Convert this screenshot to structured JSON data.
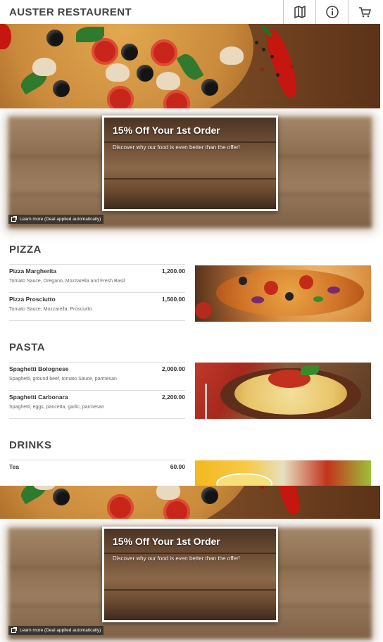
{
  "header": {
    "brand": "AUSTER RESTAURENT",
    "buttons": [
      {
        "name": "map-button",
        "icon": "map-icon"
      },
      {
        "name": "info-button",
        "icon": "info-icon"
      },
      {
        "name": "cart-button",
        "icon": "cart-icon"
      }
    ]
  },
  "promo": {
    "title": "15% Off Your 1st Order",
    "subtitle": "Discover why our food is even better than the offer!",
    "learn_more": "Learn more (Deal applied automatically)"
  },
  "menu": {
    "pizza": {
      "heading": "PIZZA",
      "items": [
        {
          "name": "Pizza Margherita",
          "price": "1,200.00",
          "desc": "Tomato Sauce, Oregano, Mozzarella and Fresh Basil"
        },
        {
          "name": "Pizza Prosciutto",
          "price": "1,500.00",
          "desc": "Tomato Sauce, Mozzarella, Prosciutto"
        }
      ]
    },
    "pasta": {
      "heading": "PASTA",
      "items": [
        {
          "name": "Spaghetti Bolognese",
          "price": "2,000.00",
          "desc": "Spaghetti, ground beef, tomato Sauce, parmesan"
        },
        {
          "name": "Spaghetti Carbonara",
          "price": "2,200.00",
          "desc": "Spaghetti, eggs, pancetta, garlic, parmesan"
        }
      ]
    },
    "drinks": {
      "heading": "DRINKS",
      "items": [
        {
          "name": "Tea",
          "price": "60.00",
          "desc": ""
        }
      ]
    }
  },
  "colors": {
    "brand_text": "#444444",
    "pepper_red": "#c5160f"
  }
}
